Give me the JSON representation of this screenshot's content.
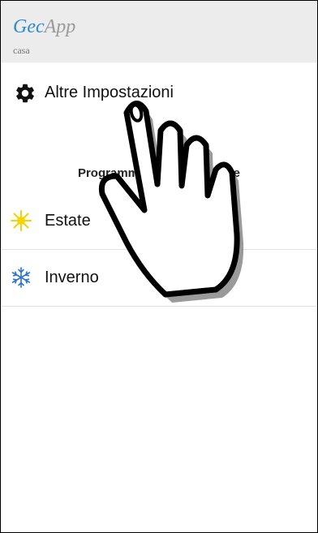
{
  "app": {
    "title_part1": "Gec",
    "title_part2": "App",
    "subtitle": "casa"
  },
  "settings": {
    "label": "Altre Impostazioni",
    "icon": "gear-icon"
  },
  "section": {
    "heading": "Programmazione stagionale"
  },
  "modes": [
    {
      "label": "Estate",
      "icon": "sun-icon",
      "color": "#f1d400"
    },
    {
      "label": "Inverno",
      "icon": "snowflake-icon",
      "color": "#2d74c9"
    }
  ],
  "overlay": {
    "icon": "pointing-hand-icon"
  }
}
